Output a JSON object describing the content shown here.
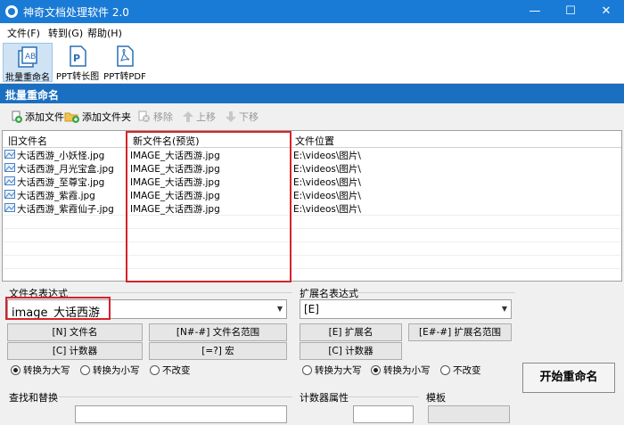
{
  "window": {
    "title": "神奇文档处理软件 2.0",
    "minimize": "—",
    "maximize": "☐",
    "close": "✕"
  },
  "menu": [
    "文件(F)",
    "转到(G)",
    "帮助(H)"
  ],
  "toolbar": [
    {
      "label": "批量重命名",
      "icon": "batch-rename-icon"
    },
    {
      "label": "PPT转长图",
      "icon": "ppt-icon"
    },
    {
      "label": "PPT转PDF",
      "icon": "pdf-icon"
    }
  ],
  "section_title": "批量重命名",
  "actions": {
    "add_file": "添加文件",
    "add_folder": "添加文件夹",
    "remove": "移除",
    "move_up": "上移",
    "move_down": "下移"
  },
  "table": {
    "columns": [
      "旧文件名",
      "新文件名(预览)",
      "文件位置"
    ],
    "rows": [
      {
        "old": "大话西游_小妖怪.jpg",
        "new": "IMAGE_大话西游.jpg",
        "path": "E:\\videos\\图片\\"
      },
      {
        "old": "大话西游_月光宝盒.jpg",
        "new": "IMAGE_大话西游.jpg",
        "path": "E:\\videos\\图片\\"
      },
      {
        "old": "大话西游_至尊宝.jpg",
        "new": "IMAGE_大话西游.jpg",
        "path": "E:\\videos\\图片\\"
      },
      {
        "old": "大话西游_紫霞.jpg",
        "new": "IMAGE_大话西游.jpg",
        "path": "E:\\videos\\图片\\"
      },
      {
        "old": "大话西游_紫霞仙子.jpg",
        "new": "IMAGE_大话西游.jpg",
        "path": "E:\\videos\\图片\\"
      }
    ]
  },
  "filename_expr": {
    "label": "文件名表达式",
    "value": "image_大话西游",
    "buttons": [
      "[N] 文件名",
      "[N#-#] 文件名范围",
      "[C] 计数器",
      "[=?] 宏"
    ],
    "case_options": [
      "转换为大写",
      "转换为小写",
      "不改变"
    ],
    "case_selected": 0
  },
  "ext_expr": {
    "label": "扩展名表达式",
    "value": "[E]",
    "buttons": [
      "[E] 扩展名",
      "[E#-#] 扩展名范围",
      "[C] 计数器"
    ],
    "case_options": [
      "转换为大写",
      "转换为小写",
      "不改变"
    ],
    "case_selected": 1
  },
  "bottom_labels": {
    "find_replace": "查找和替换",
    "counter_props": "计数器属性",
    "template": "模板"
  },
  "start_button": "开始重命名",
  "colors": {
    "titlebar": "#1a7bd6",
    "section": "#1a6fc0",
    "highlight": "#d6232a"
  }
}
